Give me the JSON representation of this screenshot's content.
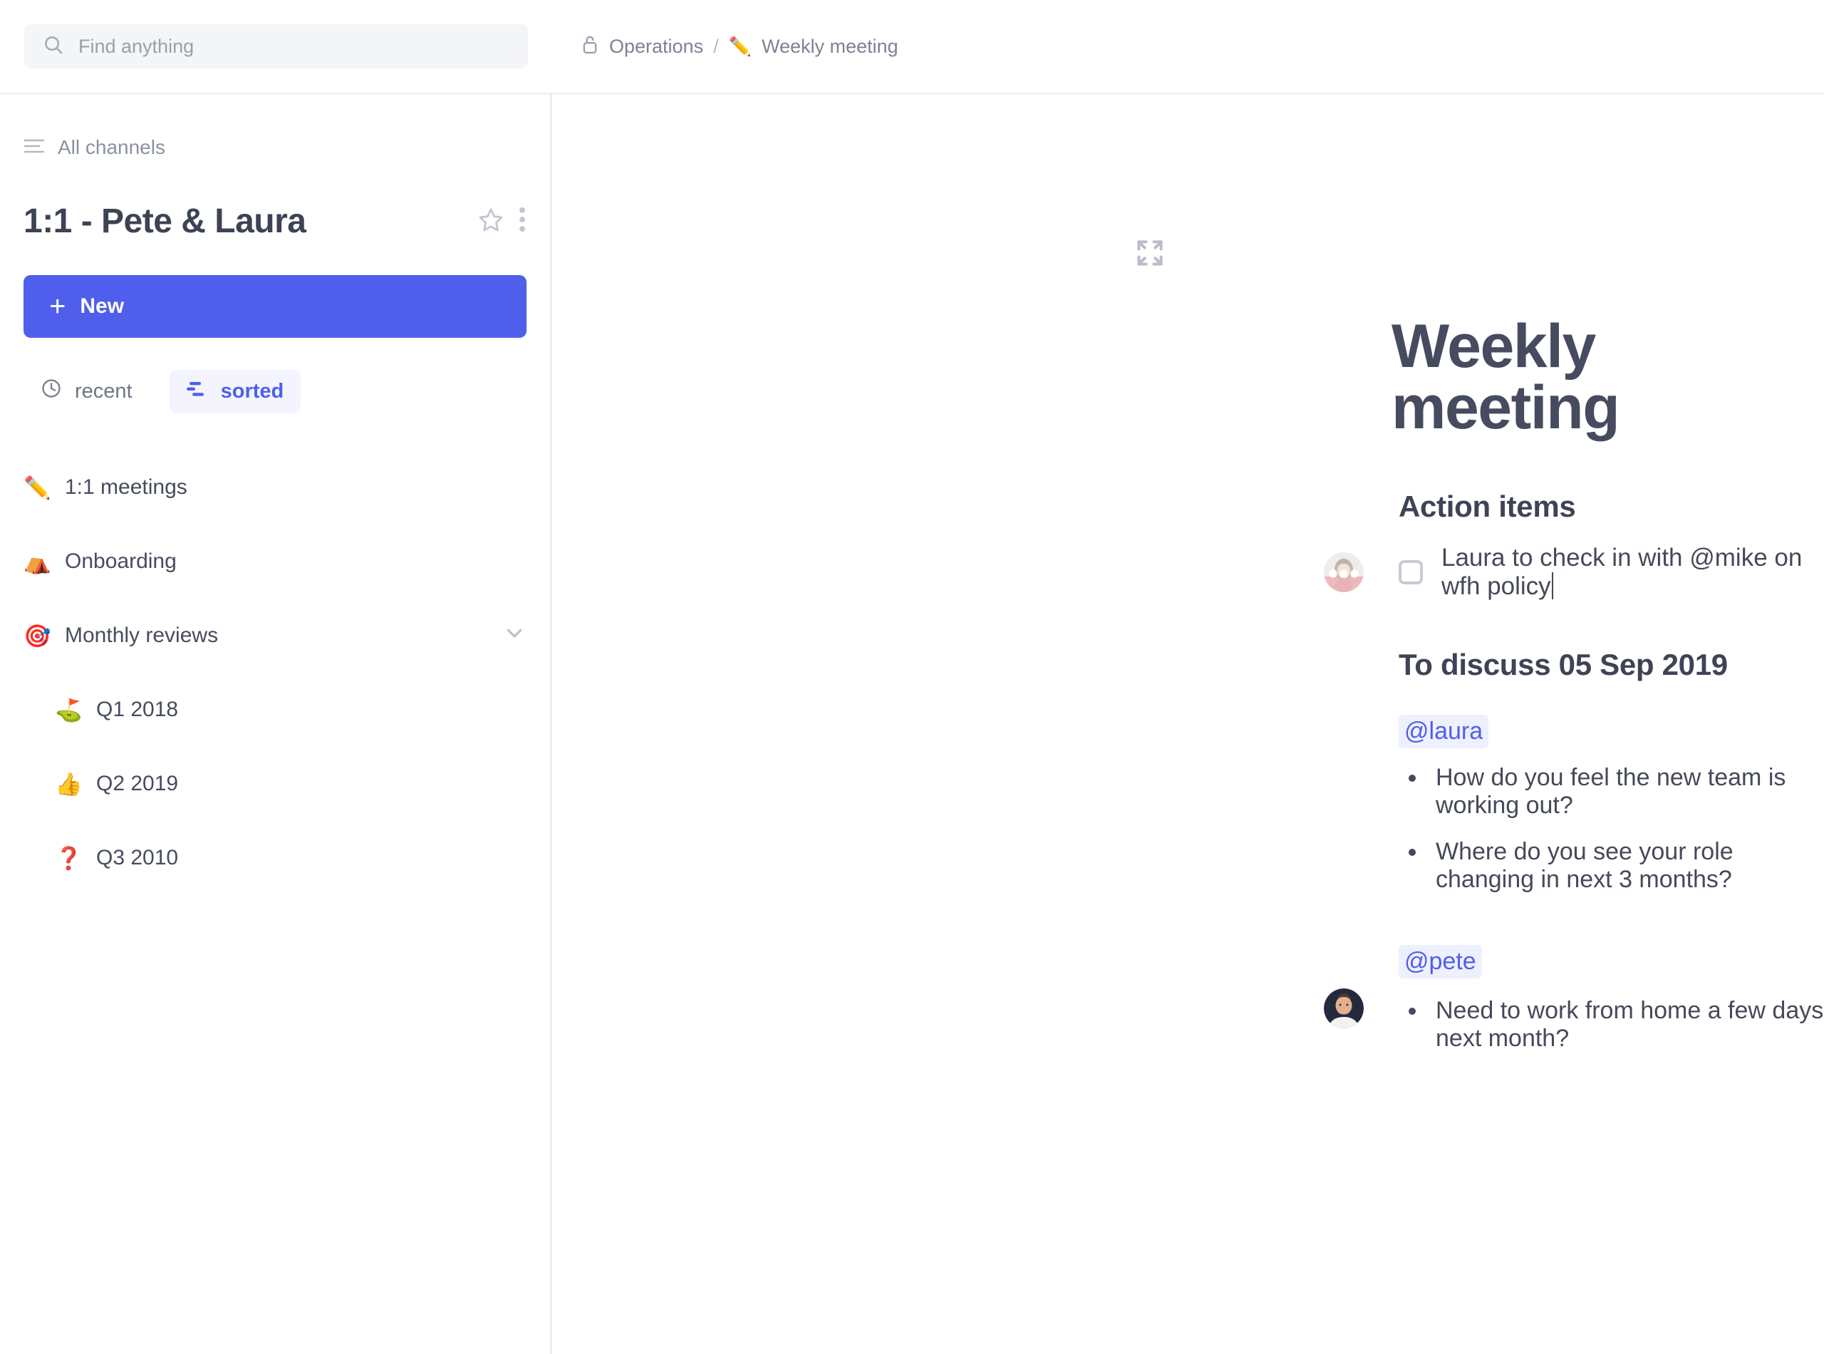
{
  "search": {
    "placeholder": "Find anything",
    "value": "",
    "icon": "search-icon"
  },
  "breadcrumb": {
    "lock_icon": "lock-icon",
    "parent": "Operations",
    "separator": "/",
    "current_emoji": "✏️",
    "current": "Weekly meeting"
  },
  "sidebar": {
    "all_channels": {
      "label": "All channels",
      "icon": "list-lines-icon"
    },
    "channel_title": "1:1 - Pete & Laura",
    "star_icon": "star-outline-icon",
    "more_icon": "kebab-menu-icon",
    "new_button": {
      "label": "New",
      "plus": "+",
      "color": "#4f5fec"
    },
    "filters": [
      {
        "label": "recent",
        "icon": "clock-icon",
        "active": false
      },
      {
        "label": "sorted",
        "icon": "sort-icon",
        "active": true
      }
    ],
    "nav_items": [
      {
        "emoji": "✏️",
        "label": "1:1 meetings",
        "level": 0,
        "chevron": false
      },
      {
        "emoji": "⛺",
        "label": "Onboarding",
        "level": 0,
        "chevron": false
      },
      {
        "emoji": "🎯",
        "label": "Monthly reviews",
        "level": 0,
        "chevron": true
      },
      {
        "emoji": "⛳",
        "label": "Q1 2018",
        "level": 1,
        "chevron": false
      },
      {
        "emoji": "👍",
        "label": "Q2 2019",
        "level": 1,
        "chevron": false
      },
      {
        "emoji": "❓",
        "label": "Q3 2010",
        "level": 1,
        "chevron": false
      }
    ]
  },
  "document": {
    "expand_icon": "expand-fullscreen-icon",
    "title": "Weekly meeting",
    "action_items": {
      "heading": "Action items",
      "tasks": [
        {
          "checked": false,
          "text": "Laura to check in with @mike on wfh policy",
          "avatar": "laura-avatar",
          "has_caret": true
        }
      ]
    },
    "to_discuss": {
      "heading": "To discuss 05 Sep 2019",
      "groups": [
        {
          "mention": "@laura",
          "avatar": null,
          "bullets": [
            "How do you feel the new team is working out?",
            "Where do you see your role changing in next 3 months?"
          ]
        },
        {
          "mention": "@pete",
          "avatar": "pete-avatar",
          "bullets": [
            "Need to work from home a few days next month?"
          ]
        }
      ]
    }
  },
  "colors": {
    "accent": "#4f5fec",
    "mention_bg": "#eef0fe",
    "text": "#454959",
    "muted": "#8b91a0"
  }
}
